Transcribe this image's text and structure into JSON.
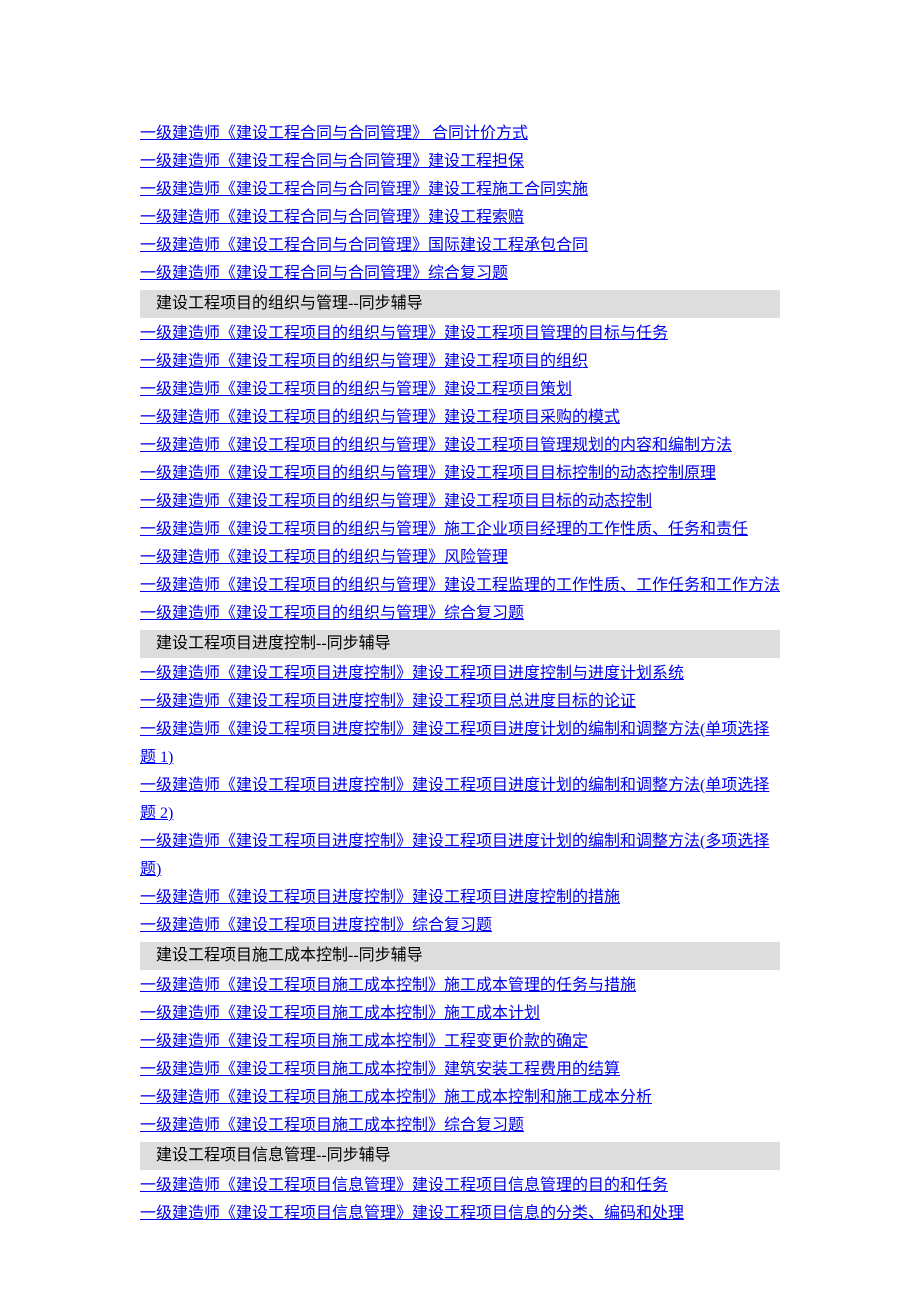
{
  "sections": [
    {
      "items": [
        "一级建造师《建设工程合同与合同管理》 合同计价方式",
        "一级建造师《建设工程合同与合同管理》建设工程担保",
        "一级建造师《建设工程合同与合同管理》建设工程施工合同实施",
        "一级建造师《建设工程合同与合同管理》建设工程索赔",
        "一级建造师《建设工程合同与合同管理》国际建设工程承包合同",
        "一级建造师《建设工程合同与合同管理》综合复习题"
      ]
    },
    {
      "header": "建设工程项目的组织与管理--同步辅导",
      "items": [
        "一级建造师《建设工程项目的组织与管理》建设工程项目管理的目标与任务",
        "一级建造师《建设工程项目的组织与管理》建设工程项目的组织",
        "一级建造师《建设工程项目的组织与管理》建设工程项目策划",
        "一级建造师《建设工程项目的组织与管理》建设工程项目采购的模式",
        "一级建造师《建设工程项目的组织与管理》建设工程项目管理规划的内容和编制方法",
        "一级建造师《建设工程项目的组织与管理》建设工程项目目标控制的动态控制原理",
        "一级建造师《建设工程项目的组织与管理》建设工程项目目标的动态控制",
        "一级建造师《建设工程项目的组织与管理》施工企业项目经理的工作性质、任务和责任",
        "一级建造师《建设工程项目的组织与管理》风险管理",
        "一级建造师《建设工程项目的组织与管理》建设工程监理的工作性质、工作任务和工作方法",
        "一级建造师《建设工程项目的组织与管理》综合复习题"
      ]
    },
    {
      "header": "建设工程项目进度控制--同步辅导",
      "items": [
        "一级建造师《建设工程项目进度控制》建设工程项目进度控制与进度计划系统",
        "一级建造师《建设工程项目进度控制》建设工程项目总进度目标的论证",
        "一级建造师《建设工程项目进度控制》建设工程项目进度计划的编制和调整方法(单项选择题 1)",
        "一级建造师《建设工程项目进度控制》建设工程项目进度计划的编制和调整方法(单项选择题 2)",
        "一级建造师《建设工程项目进度控制》建设工程项目进度计划的编制和调整方法(多项选择题)",
        "一级建造师《建设工程项目进度控制》建设工程项目进度控制的措施",
        "一级建造师《建设工程项目进度控制》综合复习题"
      ]
    },
    {
      "header": "建设工程项目施工成本控制--同步辅导",
      "items": [
        "一级建造师《建设工程项目施工成本控制》施工成本管理的任务与措施",
        "一级建造师《建设工程项目施工成本控制》施工成本计划",
        "一级建造师《建设工程项目施工成本控制》工程变更价款的确定",
        "一级建造师《建设工程项目施工成本控制》建筑安装工程费用的结算",
        "一级建造师《建设工程项目施工成本控制》施工成本控制和施工成本分析",
        "一级建造师《建设工程项目施工成本控制》综合复习题"
      ]
    },
    {
      "header": "建设工程项目信息管理--同步辅导",
      "items": [
        "一级建造师《建设工程项目信息管理》建设工程项目信息管理的目的和任务",
        "一级建造师《建设工程项目信息管理》建设工程项目信息的分类、编码和处理"
      ]
    }
  ]
}
